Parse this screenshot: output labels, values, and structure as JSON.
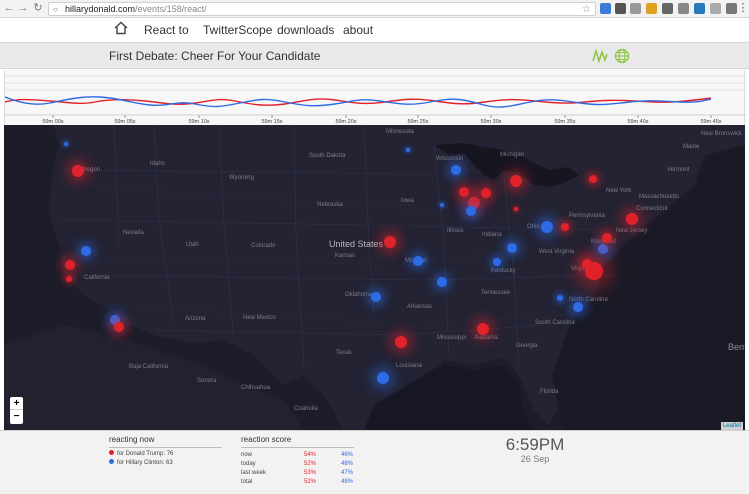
{
  "browser": {
    "url_host": "hillarydonald.com",
    "url_path": "/events/158/react/"
  },
  "site_nav": {
    "links": [
      "React to",
      "TwitterScope",
      "downloads",
      "about"
    ]
  },
  "title_bar": {
    "title": "First Debate: Cheer For Your Candidate"
  },
  "timeline": {
    "tick_labels": [
      "59m 00s",
      "59m 05s",
      "59m 10s",
      "59m 15s",
      "59m 20s",
      "59m 25s",
      "59m 30s",
      "59m 35s",
      "59m 40s",
      "59m 45s"
    ],
    "colors": {
      "trump": "#e0222b",
      "clinton": "#2e6be6"
    }
  },
  "map": {
    "labels": [
      {
        "text": "Minnesota"
      },
      {
        "text": "Oregon"
      },
      {
        "text": "Idaho"
      },
      {
        "text": "South Dakota"
      },
      {
        "text": "Wisconsin"
      },
      {
        "text": "Michigan"
      },
      {
        "text": "Maine"
      },
      {
        "text": "Wyoming"
      },
      {
        "text": "Vermont"
      },
      {
        "text": "Nebraska"
      },
      {
        "text": "Iowa"
      },
      {
        "text": "New York"
      },
      {
        "text": "Massachusetts"
      },
      {
        "text": "Connecticut"
      },
      {
        "text": "Nevada"
      },
      {
        "text": "Pennsylvania"
      },
      {
        "text": "Illinois"
      },
      {
        "text": "Indiana"
      },
      {
        "text": "Ohio"
      },
      {
        "text": "New Jersey"
      },
      {
        "text": "Utah"
      },
      {
        "text": "Colorado"
      },
      {
        "text": "United States"
      },
      {
        "text": "Maryland"
      },
      {
        "text": "West Virginia"
      },
      {
        "text": "Kansas"
      },
      {
        "text": "Missouri"
      },
      {
        "text": "Virginia"
      },
      {
        "text": "California"
      },
      {
        "text": "Kentucky"
      },
      {
        "text": "Tennessee"
      },
      {
        "text": "Oklahoma"
      },
      {
        "text": "North Carolina"
      },
      {
        "text": "Arkansas"
      },
      {
        "text": "Arizona"
      },
      {
        "text": "New Mexico"
      },
      {
        "text": "South Carolina"
      },
      {
        "text": "Mississippi"
      },
      {
        "text": "Alabama"
      },
      {
        "text": "Georgia"
      },
      {
        "text": "Texas"
      },
      {
        "text": "Baja California"
      },
      {
        "text": "Louisiana"
      },
      {
        "text": "Sonora"
      },
      {
        "text": "Chihuahua"
      },
      {
        "text": "Florida"
      },
      {
        "text": "Coahuila"
      },
      {
        "text": "New Brunswick"
      },
      {
        "text": "Bern"
      }
    ],
    "zoom_in": "+",
    "zoom_out": "−",
    "attribution": "Leaflet"
  },
  "reacting_now": {
    "heading": "reacting now",
    "rows": [
      {
        "label": "for Donald Trump: 76",
        "color": "#e0222b"
      },
      {
        "label": "for Hillary Clinton: 63",
        "color": "#2e6be6"
      }
    ]
  },
  "reaction_score": {
    "heading": "reaction score",
    "rows": [
      {
        "label": "now",
        "trump": "54%",
        "clinton": "46%"
      },
      {
        "label": "today",
        "trump": "52%",
        "clinton": "48%"
      },
      {
        "label": "last week",
        "trump": "53%",
        "clinton": "47%"
      },
      {
        "label": "total",
        "trump": "52%",
        "clinton": "48%"
      }
    ],
    "colors": {
      "trump": "#e0222b",
      "clinton": "#2e6be6"
    }
  },
  "clock": {
    "time": "6:59PM",
    "date": "26 Sep"
  }
}
